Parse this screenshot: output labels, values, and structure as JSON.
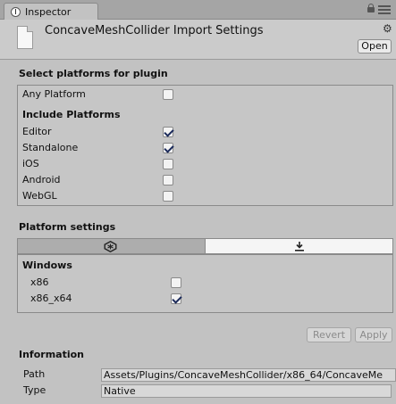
{
  "tab": {
    "label": "Inspector"
  },
  "header": {
    "title": "ConcaveMeshCollider Import Settings",
    "open_label": "Open"
  },
  "select_platforms": {
    "title": "Select platforms for plugin",
    "any_platform": {
      "label": "Any Platform",
      "checked": false
    },
    "include_title": "Include Platforms",
    "platforms": [
      {
        "label": "Editor",
        "checked": true
      },
      {
        "label": "Standalone",
        "checked": true
      },
      {
        "label": "iOS",
        "checked": false
      },
      {
        "label": "Android",
        "checked": false
      },
      {
        "label": "WebGL",
        "checked": false
      }
    ]
  },
  "platform_settings": {
    "title": "Platform settings",
    "tabs": [
      {
        "icon": "unity-icon",
        "selected": false
      },
      {
        "icon": "download-icon",
        "selected": true
      }
    ],
    "group_title": "Windows",
    "options": [
      {
        "label": "x86",
        "checked": false
      },
      {
        "label": "x86_x64",
        "checked": true
      }
    ]
  },
  "actions": {
    "revert_label": "Revert",
    "apply_label": "Apply"
  },
  "information": {
    "title": "Information",
    "path_label": "Path",
    "path_value": "Assets/Plugins/ConcaveMeshCollider/x86_64/ConcaveMe",
    "type_label": "Type",
    "type_value": "Native"
  }
}
